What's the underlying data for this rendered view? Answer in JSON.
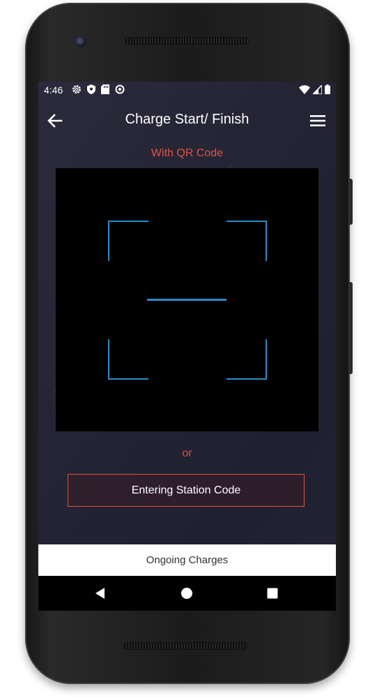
{
  "status_bar": {
    "time": "4:46",
    "left_icons": [
      "gear-icon",
      "shield-icon",
      "sd-card-icon",
      "data-saver-icon"
    ],
    "right_icons": [
      "wifi-icon",
      "signal-icon",
      "battery-icon"
    ]
  },
  "app_bar": {
    "title": "Charge Start/ Finish",
    "back_icon": "arrow-left-icon",
    "menu_icon": "hamburger-menu-icon"
  },
  "qr_section": {
    "label": "With QR Code"
  },
  "alternative": {
    "or_text": "or",
    "station_code_button": "Entering Station Code"
  },
  "bottom_bar": {
    "ongoing_label": "Ongoing Charges"
  },
  "nav_bar": {
    "icons": [
      "back-triangle-icon",
      "home-circle-icon",
      "recents-square-icon"
    ]
  },
  "colors": {
    "accent": "#e5503e",
    "scanner_frame": "#2a8bc4",
    "background": "#242435",
    "scanner_bg": "#000000"
  }
}
